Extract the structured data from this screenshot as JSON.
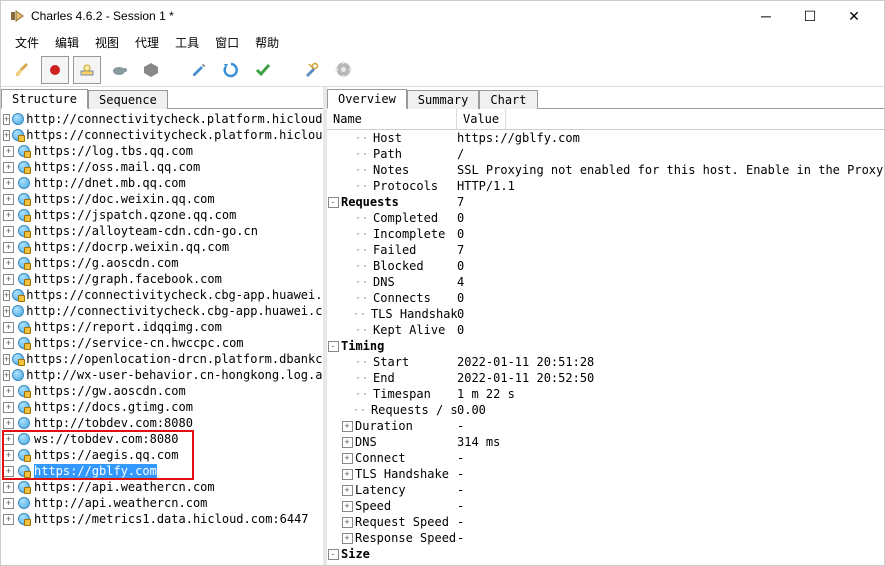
{
  "title": "Charles 4.6.2 - Session 1 *",
  "menus": [
    "文件",
    "编辑",
    "视图",
    "代理",
    "工具",
    "窗口",
    "帮助"
  ],
  "left_tabs": {
    "structure": "Structure",
    "sequence": "Sequence"
  },
  "right_tabs": {
    "overview": "Overview",
    "summary": "Summary",
    "chart": "Chart"
  },
  "detail_headers": {
    "name": "Name",
    "value": "Value"
  },
  "tree": [
    {
      "label": "http://connectivitycheck.platform.hicloud.co",
      "lock": false
    },
    {
      "label": "https://connectivitycheck.platform.hicloud.co",
      "lock": true
    },
    {
      "label": "https://log.tbs.qq.com",
      "lock": true
    },
    {
      "label": "https://oss.mail.qq.com",
      "lock": true
    },
    {
      "label": "http://dnet.mb.qq.com",
      "lock": false
    },
    {
      "label": "https://doc.weixin.qq.com",
      "lock": true
    },
    {
      "label": "https://jspatch.qzone.qq.com",
      "lock": true
    },
    {
      "label": "https://alloyteam-cdn.cdn-go.cn",
      "lock": true
    },
    {
      "label": "https://docrp.weixin.qq.com",
      "lock": true
    },
    {
      "label": "https://g.aoscdn.com",
      "lock": true
    },
    {
      "label": "https://graph.facebook.com",
      "lock": true
    },
    {
      "label": "https://connectivitycheck.cbg-app.huawei.co",
      "lock": true
    },
    {
      "label": "http://connectivitycheck.cbg-app.huawei.co",
      "lock": false
    },
    {
      "label": "https://report.idqqimg.com",
      "lock": true
    },
    {
      "label": "https://service-cn.hwccpc.com",
      "lock": true
    },
    {
      "label": "https://openlocation-drcn.platform.dbankclo",
      "lock": true
    },
    {
      "label": "http://wx-user-behavior.cn-hongkong.log.ali",
      "lock": false
    },
    {
      "label": "https://gw.aoscdn.com",
      "lock": true
    },
    {
      "label": "https://docs.gtimg.com",
      "lock": true
    },
    {
      "label": "http://tobdev.com:8080",
      "lock": false
    },
    {
      "label": "ws://tobdev.com:8080",
      "lock": false
    },
    {
      "label": "https://aegis.qq.com",
      "lock": true
    },
    {
      "label": "https://gblfy.com",
      "lock": true,
      "selected": true
    },
    {
      "label": "https://api.weathercn.com",
      "lock": true
    },
    {
      "label": "http://api.weathercn.com",
      "lock": false
    },
    {
      "label": "https://metrics1.data.hicloud.com:6447",
      "lock": true
    }
  ],
  "red_box_rows": [
    20,
    22
  ],
  "details": [
    {
      "depth": 1,
      "name": "Host",
      "value": "https://gblfy.com"
    },
    {
      "depth": 1,
      "name": "Path",
      "value": "/"
    },
    {
      "depth": 1,
      "name": "Notes",
      "value": "SSL Proxying not enabled for this host. Enable in the Proxy Menu, SSL ..."
    },
    {
      "depth": 1,
      "name": "Protocols",
      "value": "HTTP/1.1"
    },
    {
      "depth": 0,
      "exp": "-",
      "name": "Requests",
      "bold": true,
      "value": "7"
    },
    {
      "depth": 1,
      "name": "Completed",
      "value": "0"
    },
    {
      "depth": 1,
      "name": "Incomplete",
      "value": "0"
    },
    {
      "depth": 1,
      "name": "Failed",
      "value": "7"
    },
    {
      "depth": 1,
      "name": "Blocked",
      "value": "0"
    },
    {
      "depth": 1,
      "name": "DNS",
      "value": "4"
    },
    {
      "depth": 1,
      "name": "Connects",
      "value": "0"
    },
    {
      "depth": 1,
      "name": "TLS Handshakes",
      "value": "0"
    },
    {
      "depth": 1,
      "name": "Kept Alive",
      "value": "0"
    },
    {
      "depth": 0,
      "exp": "-",
      "name": "Timing",
      "bold": true,
      "value": ""
    },
    {
      "depth": 1,
      "name": "Start",
      "value": "2022-01-11 20:51:28"
    },
    {
      "depth": 1,
      "name": "End",
      "value": "2022-01-11 20:52:50"
    },
    {
      "depth": 1,
      "name": "Timespan",
      "value": "1 m 22 s"
    },
    {
      "depth": 1,
      "name": "Requests / sec",
      "value": "0.00"
    },
    {
      "depth": 1,
      "exp": "+",
      "name": "Duration",
      "value": "-"
    },
    {
      "depth": 1,
      "exp": "+",
      "name": "DNS",
      "value": "314 ms"
    },
    {
      "depth": 1,
      "exp": "+",
      "name": "Connect",
      "value": "-"
    },
    {
      "depth": 1,
      "exp": "+",
      "name": "TLS Handshake",
      "value": "-"
    },
    {
      "depth": 1,
      "exp": "+",
      "name": "Latency",
      "value": "-"
    },
    {
      "depth": 1,
      "exp": "+",
      "name": "Speed",
      "value": "-"
    },
    {
      "depth": 1,
      "exp": "+",
      "name": "Request Speed",
      "value": "-"
    },
    {
      "depth": 1,
      "exp": "+",
      "name": "Response Speed",
      "value": "-"
    },
    {
      "depth": 0,
      "exp": "-",
      "name": "Size",
      "bold": true,
      "value": ""
    }
  ]
}
